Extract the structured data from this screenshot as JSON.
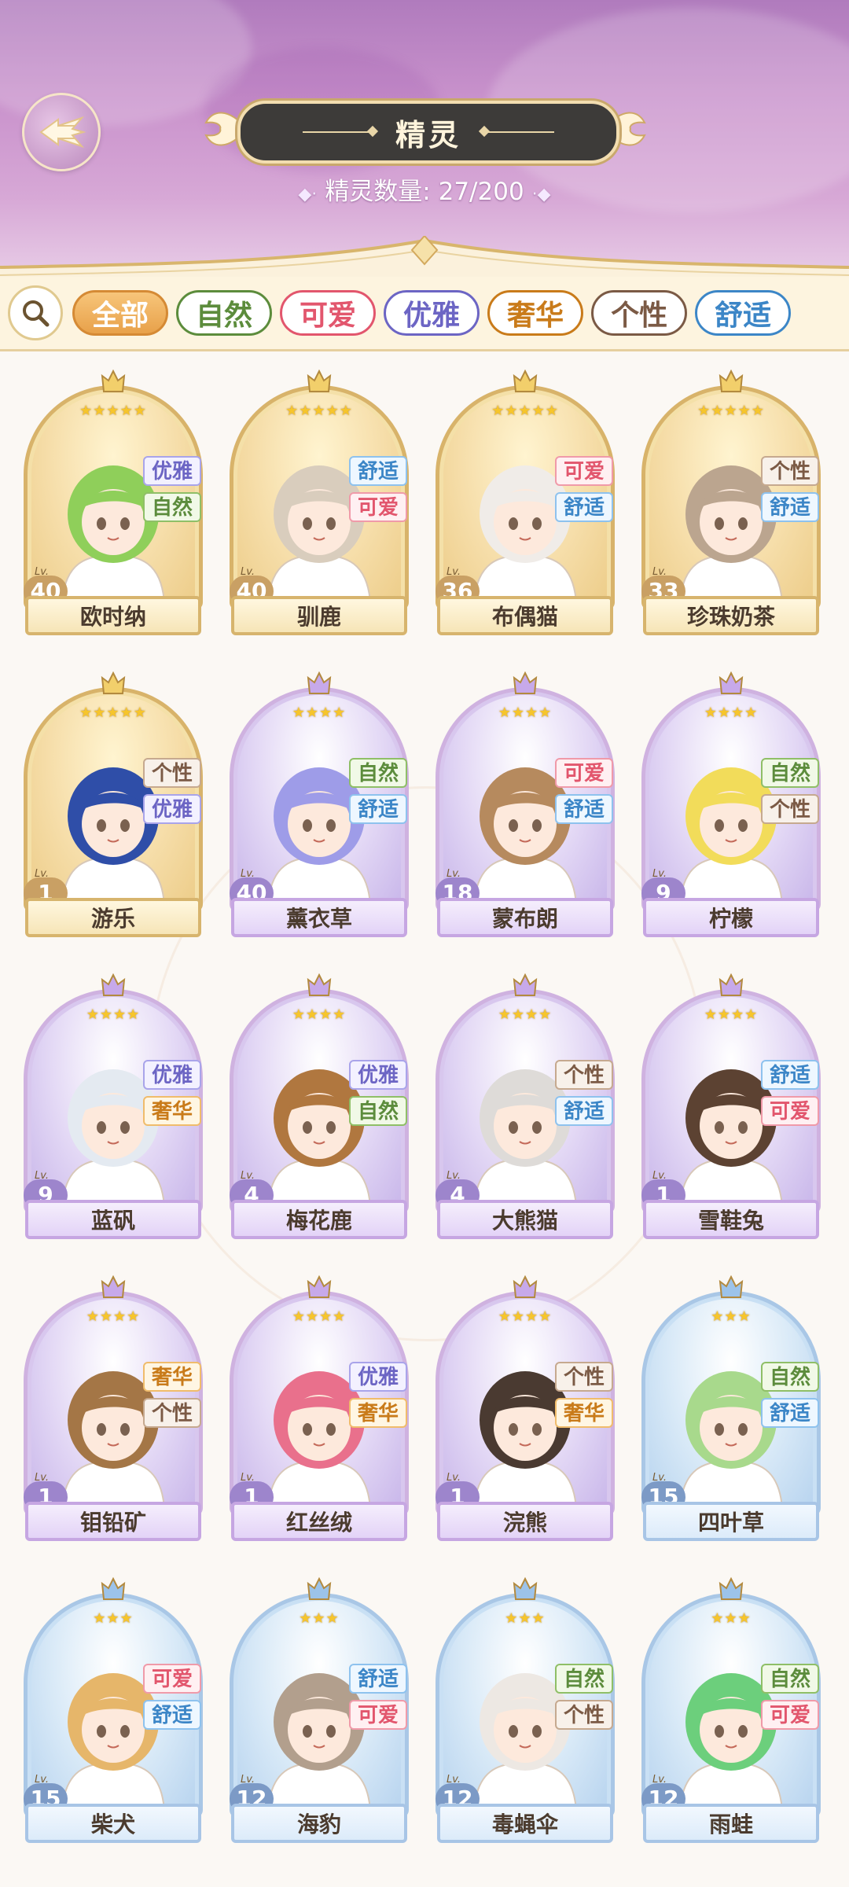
{
  "header": {
    "title": "精灵",
    "count_text": "精灵数量: 27/200",
    "back_icon": "wing-arrow-back-icon"
  },
  "filters": [
    {
      "label": "全部",
      "active": true,
      "color": "#e8a14a"
    },
    {
      "label": "自然",
      "active": false,
      "color": "#5c8c3c"
    },
    {
      "label": "可爱",
      "active": false,
      "color": "#e2566d"
    },
    {
      "label": "优雅",
      "active": false,
      "color": "#6c65c4"
    },
    {
      "label": "奢华",
      "active": false,
      "color": "#c97b1a"
    },
    {
      "label": "个性",
      "active": false,
      "color": "#7b5a45"
    },
    {
      "label": "舒适",
      "active": false,
      "color": "#3c86c7"
    }
  ],
  "spirits": [
    {
      "name": "欧时纳",
      "level": "40",
      "tags": [
        "优雅",
        "自然"
      ],
      "stars": 5,
      "rarity": "gold",
      "hair": "#8fcf5a"
    },
    {
      "name": "驯鹿",
      "level": "40",
      "tags": [
        "舒适",
        "可爱"
      ],
      "stars": 5,
      "rarity": "gold",
      "hair": "#d9cdbd"
    },
    {
      "name": "布偶猫",
      "level": "36",
      "tags": [
        "可爱",
        "舒适"
      ],
      "stars": 5,
      "rarity": "gold",
      "hair": "#f0ece8"
    },
    {
      "name": "珍珠奶茶",
      "level": "33",
      "tags": [
        "个性",
        "舒适"
      ],
      "stars": 5,
      "rarity": "gold",
      "hair": "#bba58f"
    },
    {
      "name": "游乐",
      "level": "1",
      "tags": [
        "个性",
        "优雅"
      ],
      "stars": 5,
      "rarity": "gold",
      "hair": "#2f4ea8"
    },
    {
      "name": "薰衣草",
      "level": "40",
      "tags": [
        "自然",
        "舒适"
      ],
      "stars": 4,
      "rarity": "purple",
      "hair": "#9e9ce8"
    },
    {
      "name": "蒙布朗",
      "level": "18",
      "tags": [
        "可爱",
        "舒适"
      ],
      "stars": 4,
      "rarity": "purple",
      "hair": "#b68a5e"
    },
    {
      "name": "柠檬",
      "level": "9",
      "tags": [
        "自然",
        "个性"
      ],
      "stars": 4,
      "rarity": "purple",
      "hair": "#f2dc5a"
    },
    {
      "name": "蓝矾",
      "level": "9",
      "tags": [
        "优雅",
        "奢华"
      ],
      "stars": 4,
      "rarity": "purple",
      "hair": "#e4eaf1"
    },
    {
      "name": "梅花鹿",
      "level": "4",
      "tags": [
        "优雅",
        "自然"
      ],
      "stars": 4,
      "rarity": "purple",
      "hair": "#b0773f"
    },
    {
      "name": "大熊猫",
      "level": "4",
      "tags": [
        "个性",
        "舒适"
      ],
      "stars": 4,
      "rarity": "purple",
      "hair": "#dedbd8"
    },
    {
      "name": "雪鞋兔",
      "level": "1",
      "tags": [
        "舒适",
        "可爱"
      ],
      "stars": 4,
      "rarity": "purple",
      "hair": "#5c4232"
    },
    {
      "name": "钼铅矿",
      "level": "1",
      "tags": [
        "奢华",
        "个性"
      ],
      "stars": 4,
      "rarity": "purple",
      "hair": "#a47646"
    },
    {
      "name": "红丝绒",
      "level": "1",
      "tags": [
        "优雅",
        "奢华"
      ],
      "stars": 4,
      "rarity": "purple",
      "hair": "#e9708c"
    },
    {
      "name": "浣熊",
      "level": "1",
      "tags": [
        "个性",
        "奢华"
      ],
      "stars": 4,
      "rarity": "purple",
      "hair": "#4a3a31"
    },
    {
      "name": "四叶草",
      "level": "15",
      "tags": [
        "自然",
        "舒适"
      ],
      "stars": 3,
      "rarity": "blue",
      "hair": "#a8d98c"
    },
    {
      "name": "柴犬",
      "level": "15",
      "tags": [
        "可爱",
        "舒适"
      ],
      "stars": 3,
      "rarity": "blue",
      "hair": "#e6b66a"
    },
    {
      "name": "海豹",
      "level": "12",
      "tags": [
        "舒适",
        "可爱"
      ],
      "stars": 3,
      "rarity": "blue",
      "hair": "#b29f8d"
    },
    {
      "name": "毒蝇伞",
      "level": "12",
      "tags": [
        "自然",
        "个性"
      ],
      "stars": 3,
      "rarity": "blue",
      "hair": "#ede8e3"
    },
    {
      "name": "雨蛙",
      "level": "12",
      "tags": [
        "自然",
        "可爱"
      ],
      "stars": 3,
      "rarity": "blue",
      "hair": "#6ccf7c"
    }
  ],
  "lv_label": "Lv."
}
